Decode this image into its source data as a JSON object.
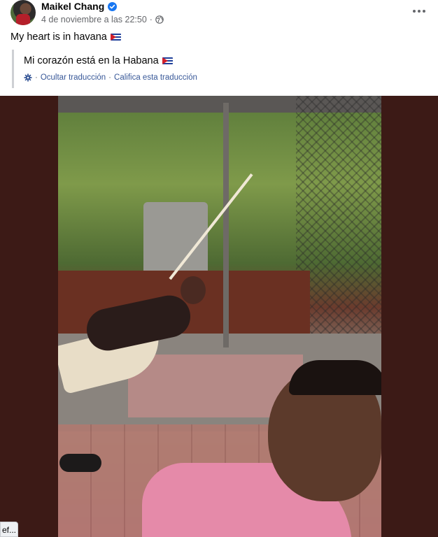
{
  "post": {
    "author": "Maikel Chang",
    "timestamp": "4 de noviembre a las 22:50",
    "separator": "·",
    "privacy_icon": "globe-icon",
    "verified_icon": "verified-badge-icon",
    "more_icon": "more-options-icon",
    "text": "My heart is in havana"
  },
  "translation": {
    "text": "Mi corazón está en la Habana",
    "settings_icon": "gear-icon",
    "hide_label": "Ocultar traducción",
    "separator": "·",
    "rate_label": "Califica esta traducción"
  },
  "tooltip": {
    "text": "ef..."
  },
  "colors": {
    "link": "#385898",
    "secondary_text": "#65676b",
    "photo_frame": "#3c1a16",
    "verified": "#1877f2"
  }
}
